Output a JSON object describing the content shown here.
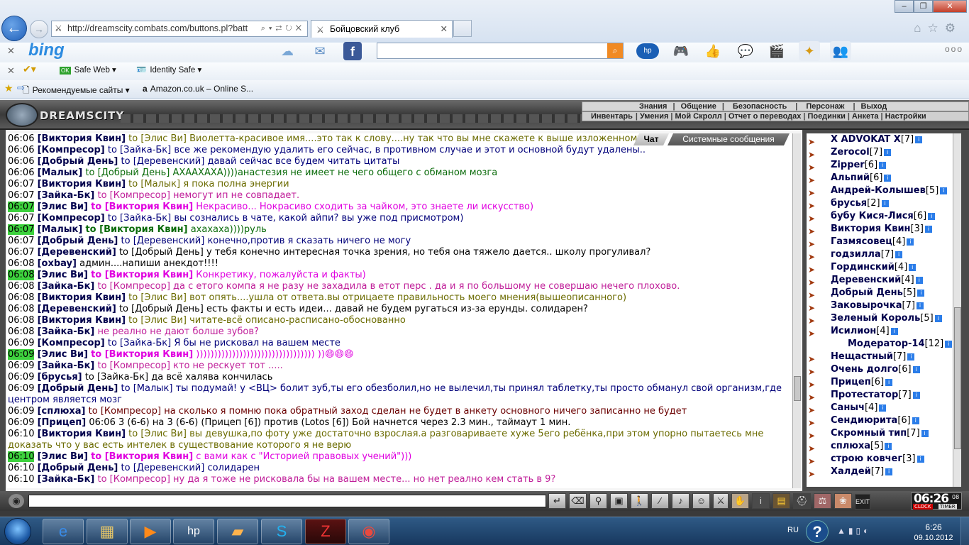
{
  "browser": {
    "url": "http://dreamscity.combats.com/buttons.pl?batt",
    "tab_title": "Бойцовский клуб",
    "bing_label": "bing",
    "safe_web": "Safe Web",
    "identity_safe": "Identity Safe",
    "favorites": [
      "Рекомендуемые сайты",
      "Amazon.co.uk – Online S..."
    ],
    "hp_label": "hp"
  },
  "game": {
    "title": "DREAMSCITY",
    "menu_top": [
      "Знания",
      "Общение",
      "Безопасность",
      "Персонаж",
      "Выход"
    ],
    "menu_bottom": [
      "Инвентарь",
      "Умения",
      "Мой Скролл",
      "Отчет о переводах",
      "Поединки",
      "Анкета",
      "Настройки"
    ],
    "chat_tabs": [
      "Чат",
      "Системные сообщения"
    ],
    "messages": [
      {
        "time": "06:06",
        "hl": false,
        "nick": "[Виктория Квин]",
        "to": "to [Элис Ви]",
        "text": "Виолетта-красивое имя....это так к слову....ну так что вы мне скажете к выше изложенному?",
        "color": "#6b6b00",
        "nickColor": "#00004d",
        "toBold": false
      },
      {
        "time": "06:06",
        "hl": false,
        "nick": "[Компресор]",
        "to": "to [Зайка-Бк]",
        "text": "все же рекомендую удалить его сейчас, в противном случае и этот и основной будут удалены..",
        "color": "#00007a",
        "nickColor": "#00004d",
        "toBold": false
      },
      {
        "time": "06:06",
        "hl": false,
        "nick": "[Добрый День]",
        "to": "to [Деревенский]",
        "text": "давай сейчас все будем читать цитаты",
        "color": "#00007a",
        "nickColor": "#00004d",
        "toBold": false
      },
      {
        "time": "06:06",
        "hl": false,
        "nick": "[Малык]",
        "to": "to [Добрый День]",
        "text": "АХААХАХА))))анастезия не имеет не чего общего с обманом мозга",
        "color": "#0a6b0a",
        "nickColor": "#00004d",
        "toBold": false
      },
      {
        "time": "06:07",
        "hl": false,
        "nick": "[Виктория Квин]",
        "to": "to [Малык]",
        "text": "я пока полна энергии",
        "color": "#6b6b00",
        "nickColor": "#00004d",
        "toBold": false
      },
      {
        "time": "06:07",
        "hl": false,
        "nick": "[Зайка-Бк]",
        "to": "to [Компресор]",
        "text": "немогут ип не совпадает.",
        "color": "#c0209a",
        "nickColor": "#00004d",
        "toBold": false
      },
      {
        "time": "06:07",
        "hl": true,
        "nick": "[Элис Ви]",
        "to": "to [Виктория Квин]",
        "text": "Некрасиво... Нокрасиво сходить за чайком, это знаете ли искусство)",
        "color": "#e000e0",
        "nickColor": "#00004d",
        "toBold": true
      },
      {
        "time": "06:07",
        "hl": false,
        "nick": "[Компресор]",
        "to": "to [Зайка-Бк]",
        "text": "вы сознались в чате, какой айпи? вы уже под присмотром)",
        "color": "#00007a",
        "nickColor": "#00004d",
        "toBold": false
      },
      {
        "time": "06:07",
        "hl": true,
        "nick": "[Малык]",
        "to": "to [Виктория Квин]",
        "text": "ахахаха))))руль",
        "color": "#0a6b0a",
        "nickColor": "#00004d",
        "toBold": true
      },
      {
        "time": "06:07",
        "hl": false,
        "nick": "[Добрый День]",
        "to": "to [Деревенский]",
        "text": "конечно,против я сказать ничего не могу",
        "color": "#00007a",
        "nickColor": "#00004d",
        "toBold": false
      },
      {
        "time": "06:07",
        "hl": false,
        "nick": "[Деревенский]",
        "to": "to [Добрый День]",
        "text": "у тебя конечно интересная точка зрения, но тебя она тяжело дается.. школу прогуливал?",
        "color": "#000",
        "nickColor": "#00004d",
        "toBold": false
      },
      {
        "time": "06:08",
        "hl": false,
        "nick": "[oxbay]",
        "to": "",
        "text": "админ....напиши анекдот!!!!",
        "color": "#000",
        "nickColor": "#00004d",
        "toBold": false
      },
      {
        "time": "06:08",
        "hl": true,
        "nick": "[Элис Ви]",
        "to": "to [Виктория Квин]",
        "text": "Конкретику, пожалуйста и факты)",
        "color": "#e000e0",
        "nickColor": "#00004d",
        "toBold": true
      },
      {
        "time": "06:08",
        "hl": false,
        "nick": "[Зайка-Бк]",
        "to": "to [Компресор]",
        "text": "да с етого компа я не разу не захадила в етот перс . да и я по большому не совершаю нечего плохово.",
        "color": "#c0209a",
        "nickColor": "#00004d",
        "toBold": false
      },
      {
        "time": "06:08",
        "hl": false,
        "nick": "[Виктория Квин]",
        "to": "to [Элис Ви]",
        "text": "вот опять....ушла от ответа.вы отрицаете правильность моего мнения(вышеописанного)",
        "color": "#6b6b00",
        "nickColor": "#00004d",
        "toBold": false
      },
      {
        "time": "06:08",
        "hl": false,
        "nick": "[Деревенский]",
        "to": "to [Добрый День]",
        "text": "есть факты и есть идеи... давай не будем ругаться из-за ерунды. солидарен?",
        "color": "#000",
        "nickColor": "#00004d",
        "toBold": false
      },
      {
        "time": "06:08",
        "hl": false,
        "nick": "[Виктория Квин]",
        "to": "to [Элис Ви]",
        "text": "читате-всё описано-расписано-обоснованно",
        "color": "#6b6b00",
        "nickColor": "#00004d",
        "toBold": false
      },
      {
        "time": "06:08",
        "hl": false,
        "nick": "[Зайка-Бк]",
        "to": "",
        "text": "не реално не дают болше зубов?",
        "color": "#c0209a",
        "nickColor": "#00004d",
        "toBold": false
      },
      {
        "time": "06:09",
        "hl": false,
        "nick": "[Компресор]",
        "to": "to [Зайка-Бк]",
        "text": "Я бы не рисковал на вашем месте",
        "color": "#00007a",
        "nickColor": "#00004d",
        "toBold": false
      },
      {
        "time": "06:09",
        "hl": true,
        "nick": "[Элис Ви]",
        "to": "to [Виктория Квин]",
        "text": "))))))))))))))))))))))))))))))))) ))😄😄😄",
        "color": "#e000e0",
        "nickColor": "#00004d",
        "toBold": true
      },
      {
        "time": "06:09",
        "hl": false,
        "nick": "[Зайка-Бк]",
        "to": "to [Компресор]",
        "text": "кто не рескует тот .....",
        "color": "#c0209a",
        "nickColor": "#00004d",
        "toBold": false
      },
      {
        "time": "06:09",
        "hl": false,
        "nick": "[брусья]",
        "to": "to [Зайка-Бк]",
        "text": "да всё халява кончилась",
        "color": "#000",
        "nickColor": "#00004d",
        "toBold": false
      },
      {
        "time": "06:09",
        "hl": false,
        "nick": "[Добрый День]",
        "to": "to [Малык]",
        "text": "ты подумай! у <ВЦ> болит зуб,ты его обезболил,но не вылечил,ты принял таблетку,ты просто обманул свой организм,где центром является мозг",
        "color": "#00007a",
        "nickColor": "#00004d",
        "toBold": false
      },
      {
        "time": "06:09",
        "hl": false,
        "nick": "[сплюха]",
        "to": "to [Компресор]",
        "text": "на сколько я помню пока обратный заход сделан не будет в анкету основного ничего записанно не будет",
        "color": "#6b0000",
        "nickColor": "#00004d",
        "toBold": false
      },
      {
        "time": "06:09",
        "hl": false,
        "nick": "[Прицеп]",
        "to": "",
        "text": "06:06 3 (6-6) на 3 (6-6) (Прицеп [6]) против (Lotos [6]) Бой начнется через 2.3 мин., таймаут 1 мин.",
        "color": "#000",
        "nickColor": "#00004d",
        "toBold": false
      },
      {
        "time": "06:10",
        "hl": false,
        "nick": "[Виктория Квин]",
        "to": "to [Элис Ви]",
        "text": "вы девушка,по фоту уже достаточно взрослая.а разговариваете хуже 5его ребёнка,при этом упорно пытаетесь мне доказать что у вас есть интелек в существование которого я не верю",
        "color": "#6b6b00",
        "nickColor": "#00004d",
        "toBold": false
      },
      {
        "time": "06:10",
        "hl": true,
        "nick": "[Элис Ви]",
        "to": "to [Виктория Квин]",
        "text": "с вами как с \"Историей правовых учений\")))",
        "color": "#e000e0",
        "nickColor": "#00004d",
        "toBold": true
      },
      {
        "time": "06:10",
        "hl": false,
        "nick": "[Добрый День]",
        "to": "to [Деревенский]",
        "text": "солидарен",
        "color": "#00007a",
        "nickColor": "#00004d",
        "toBold": false
      },
      {
        "time": "06:10",
        "hl": false,
        "nick": "[Зайка-Бк]",
        "to": "to [Компресор]",
        "text": "ну да я тоже не рисковала бы на вашем месте... но нет реално кем стать в 9?",
        "color": "#c0209a",
        "nickColor": "#00004d",
        "toBold": false
      }
    ],
    "who": [
      {
        "name": "X ADVOKAT X",
        "level": "[7]"
      },
      {
        "name": "Zerocol",
        "level": "[7]"
      },
      {
        "name": "Zipper",
        "level": "[6]"
      },
      {
        "name": "Альпий",
        "level": "[6]"
      },
      {
        "name": "Андрей-Колышев",
        "level": "[5]"
      },
      {
        "name": "брусья",
        "level": "[2]"
      },
      {
        "name": "бубу Кися-Лися",
        "level": "[6]"
      },
      {
        "name": "Виктория Квин",
        "level": "[3]"
      },
      {
        "name": "Газмясовец",
        "level": "[4]"
      },
      {
        "name": "годзилла",
        "level": "[7]"
      },
      {
        "name": "Гординский",
        "level": "[4]"
      },
      {
        "name": "Деревенский",
        "level": "[4]"
      },
      {
        "name": "Добрый День",
        "level": "[5]"
      },
      {
        "name": "Заковырочка",
        "level": "[7]"
      },
      {
        "name": "Зеленый Король",
        "level": "[5]"
      },
      {
        "name": "Исилион",
        "level": "[4]"
      },
      {
        "name": "Модератор-14",
        "level": "[12]"
      },
      {
        "name": "Нещастный",
        "level": "[7]"
      },
      {
        "name": "Очень долго",
        "level": "[6]"
      },
      {
        "name": "Прицеп",
        "level": "[6]"
      },
      {
        "name": "Протестатор",
        "level": "[7]"
      },
      {
        "name": "Саныч",
        "level": "[4]"
      },
      {
        "name": "Сендиюрита",
        "level": "[6]"
      },
      {
        "name": "Скромный тип",
        "level": "[7]"
      },
      {
        "name": "сплюха",
        "level": "[5]"
      },
      {
        "name": "строю ковчег",
        "level": "[3]"
      },
      {
        "name": "Халдей",
        "level": "[7]"
      }
    ],
    "clock": {
      "time": "06:26",
      "seconds": "08",
      "label1": "CLOCK",
      "label2": "TIMER"
    }
  },
  "taskbar": {
    "lang": "RU",
    "time": "6:26",
    "date": "09.10.2012"
  }
}
